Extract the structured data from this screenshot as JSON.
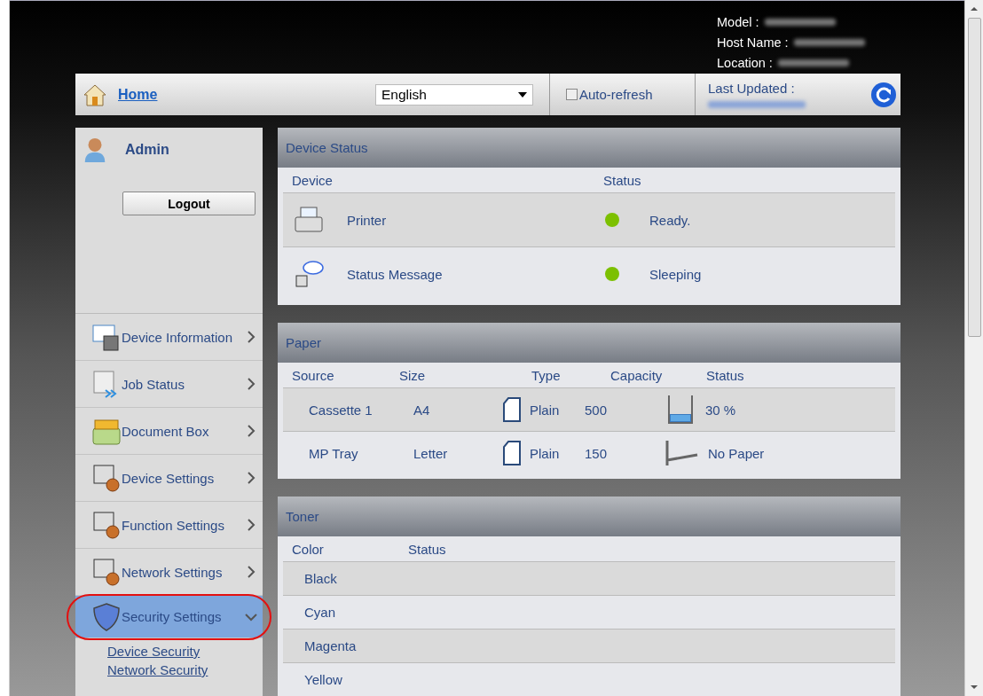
{
  "header": {
    "info": [
      {
        "label": "Model :"
      },
      {
        "label": "Host Name :"
      },
      {
        "label": "Location :"
      }
    ]
  },
  "toolbar": {
    "home": "Home",
    "language": "English",
    "auto_refresh": {
      "label": "Auto-refresh",
      "checked": false
    },
    "last_updated": "Last Updated :"
  },
  "user": {
    "name": "Admin",
    "logout": "Logout"
  },
  "nav": [
    {
      "label": "Device Information",
      "kind": "info",
      "selected": false,
      "expanded": false,
      "highlighted": false
    },
    {
      "label": "Job Status",
      "kind": "jobs",
      "selected": false,
      "expanded": false,
      "highlighted": false
    },
    {
      "label": "Document Box",
      "kind": "box",
      "selected": false,
      "expanded": false,
      "highlighted": false
    },
    {
      "label": "Device Settings",
      "kind": "device",
      "selected": false,
      "expanded": false,
      "highlighted": false
    },
    {
      "label": "Function Settings",
      "kind": "function",
      "selected": false,
      "expanded": false,
      "highlighted": false
    },
    {
      "label": "Network Settings",
      "kind": "network",
      "selected": false,
      "expanded": false,
      "highlighted": false
    },
    {
      "label": "Security Settings",
      "kind": "security",
      "selected": true,
      "expanded": true,
      "highlighted": true,
      "children": [
        {
          "label": "Device Security"
        },
        {
          "label": "Network Security"
        }
      ]
    }
  ],
  "device_status": {
    "title": "Device Status",
    "columns": [
      "Device",
      "Status"
    ],
    "rows": [
      {
        "kind": "printer",
        "device": "Printer",
        "status": "Ready.",
        "color": "#7cc000"
      },
      {
        "kind": "message",
        "device": "Status Message",
        "status": "Sleeping",
        "color": "#7cc000"
      }
    ]
  },
  "paper": {
    "title": "Paper",
    "columns": [
      "Source",
      "Size",
      "Type",
      "Capacity",
      "Status"
    ],
    "rows": [
      {
        "source": "Cassette 1",
        "size": "A4",
        "type": "Plain",
        "capacity": "500",
        "level": 0.3,
        "status": "30 %"
      },
      {
        "source": "MP Tray",
        "size": "Letter",
        "type": "Plain",
        "capacity": "150",
        "status": "No Paper"
      }
    ]
  },
  "toner": {
    "title": "Toner",
    "columns": [
      "Color",
      "Status"
    ],
    "rows": [
      {
        "color_name": "Black"
      },
      {
        "color_name": "Cyan"
      },
      {
        "color_name": "Magenta"
      },
      {
        "color_name": "Yellow"
      }
    ]
  }
}
